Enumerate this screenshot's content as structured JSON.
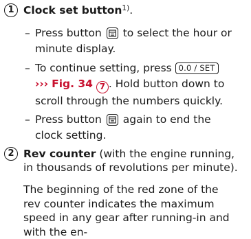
{
  "item1": {
    "number": "1",
    "title": "Clock set button",
    "footnote": "1)",
    "title_end": ".",
    "bullets": [
      {
        "dash": "–",
        "before": "Press button",
        "after": "to select the hour or minute display."
      },
      {
        "dash": "–",
        "before": "To continue setting, press",
        "key": "0.0 / SET",
        "ref_arrow": "›››",
        "ref_fig": "Fig. 34",
        "ref_num": "7",
        "after": ". Hold button down to scroll through the numbers quickly."
      },
      {
        "dash": "–",
        "before": "Press button",
        "after": "again to end the clock setting."
      }
    ]
  },
  "item2": {
    "number": "2",
    "title": "Rev counter",
    "rest": "(with the engine running, in thousands of revolutions per minute).",
    "paragraph": "The beginning of the red zone of the rev counter indicates the maximum speed in any gear after running-in and with the en-"
  },
  "colors": {
    "reference": "#c8102e",
    "text": "#1a1a1a"
  },
  "icons": {
    "button": "display-mode-button-icon"
  }
}
